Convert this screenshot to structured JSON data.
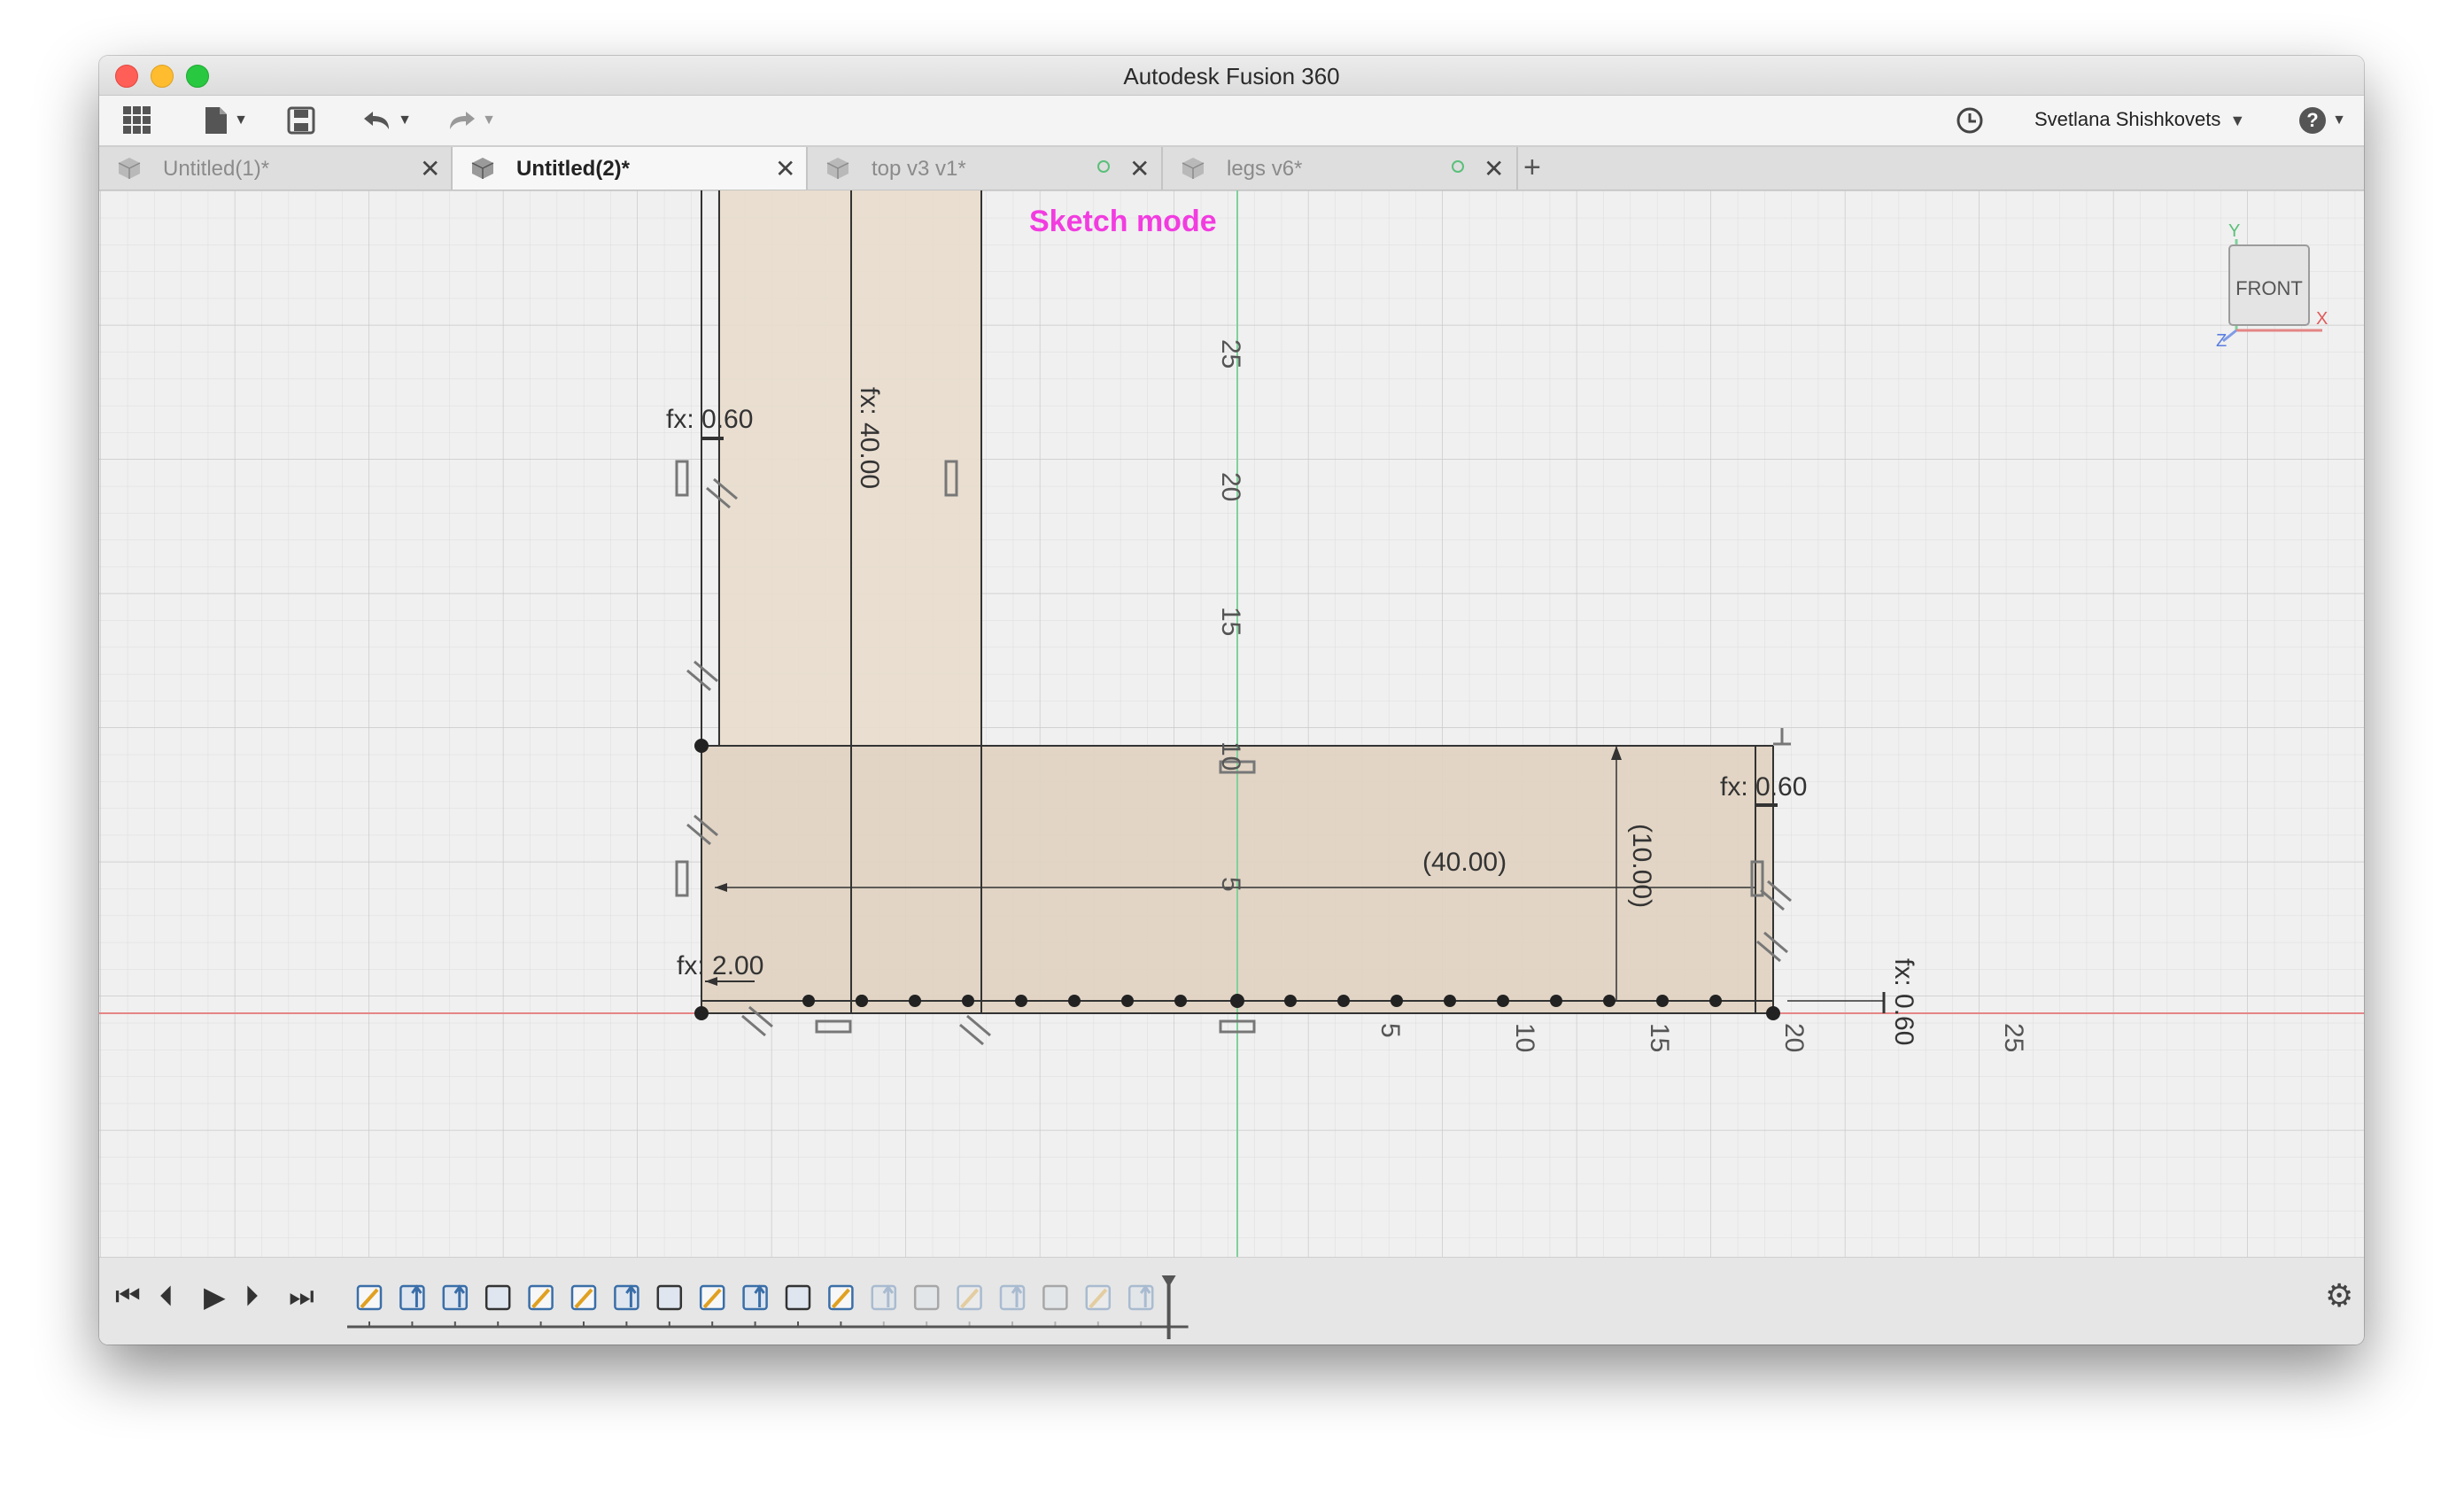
{
  "window": {
    "title": "Autodesk Fusion 360"
  },
  "toolbar": {
    "user_name": "Svetlana Shishkovets",
    "icons": [
      "grid-icon",
      "file-icon",
      "save-icon",
      "undo-icon",
      "redo-icon",
      "clock-icon",
      "help-icon"
    ]
  },
  "tabs": [
    {
      "label": "Untitled(1)*",
      "active": false,
      "status_dot": false
    },
    {
      "label": "Untitled(2)*",
      "active": true,
      "status_dot": false
    },
    {
      "label": "top v3 v1*",
      "active": false,
      "status_dot": true
    },
    {
      "label": "legs v6*",
      "active": false,
      "status_dot": true
    }
  ],
  "new_tab_label": "+",
  "canvas": {
    "mode_label": "Sketch mode",
    "mode_color": "#f23ce0",
    "viewcube": {
      "face": "FRONT",
      "x_label": "X",
      "y_label": "Y",
      "z_label": "Z"
    },
    "vertical_axis_labels": [
      "25",
      "20",
      "15",
      "10",
      "5"
    ],
    "horizontal_axis_labels": [
      "5",
      "10",
      "15",
      "20",
      "25"
    ],
    "dimensions": {
      "top_left_width": "fx: 0.60",
      "leg_height": "fx: 40.00",
      "right_width": "fx: 0.60",
      "shelf_length": "(40.00)",
      "shelf_height": "(10.00)",
      "bottom_offset": "fx: 2.00",
      "far_right": "fx: 0.60"
    },
    "colors": {
      "fill": "#e3d6c5",
      "x_axis": "#e58585",
      "y_axis": "#7fd19a",
      "grid": "#d6d6d6"
    }
  },
  "timeline": {
    "playback_icons": [
      "skip-start-icon",
      "step-back-icon",
      "play-icon",
      "step-forward-icon",
      "skip-end-icon"
    ],
    "feature_count": 19,
    "settings_icon": "gear-icon"
  }
}
